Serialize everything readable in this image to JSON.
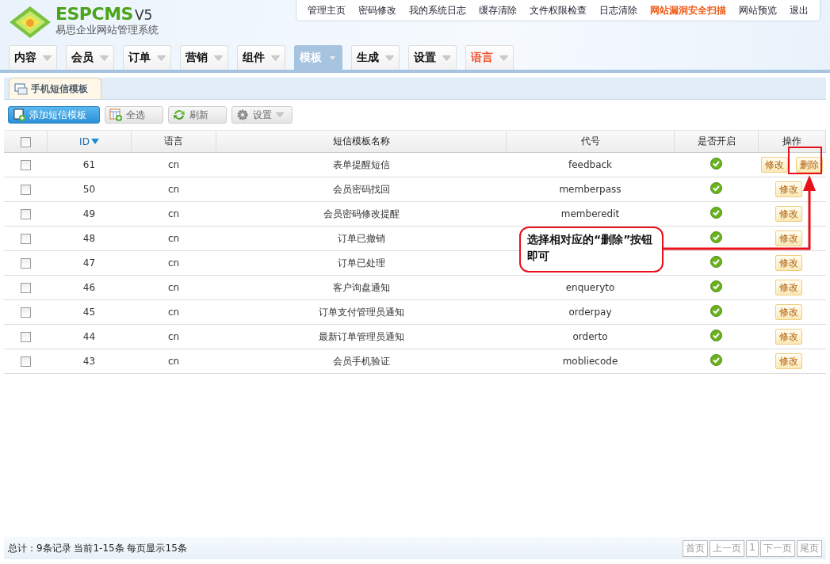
{
  "logo": {
    "brand": "ESPCMS",
    "version": "V5",
    "subtitle": "易思企业网站管理系统"
  },
  "top_links": [
    {
      "label": "管理主页",
      "highlight": false
    },
    {
      "label": "密码修改",
      "highlight": false
    },
    {
      "label": "我的系统日志",
      "highlight": false
    },
    {
      "label": "缓存清除",
      "highlight": false
    },
    {
      "label": "文件权限检查",
      "highlight": false
    },
    {
      "label": "日志清除",
      "highlight": false
    },
    {
      "label": "网站漏洞安全扫描",
      "highlight": true
    },
    {
      "label": "网站预览",
      "highlight": false
    },
    {
      "label": "退出",
      "highlight": false
    }
  ],
  "nav_tabs": [
    {
      "label": "内容",
      "selected": false,
      "highlight": false
    },
    {
      "label": "会员",
      "selected": false,
      "highlight": false
    },
    {
      "label": "订单",
      "selected": false,
      "highlight": false
    },
    {
      "label": "营销",
      "selected": false,
      "highlight": false
    },
    {
      "label": "组件",
      "selected": false,
      "highlight": false
    },
    {
      "label": "模板",
      "selected": true,
      "highlight": false
    },
    {
      "label": "生成",
      "selected": false,
      "highlight": false
    },
    {
      "label": "设置",
      "selected": false,
      "highlight": false
    },
    {
      "label": "语言",
      "selected": false,
      "highlight": true
    }
  ],
  "panel_tab": "手机短信模板",
  "toolbar": [
    {
      "label": "添加短信模板",
      "kind": "primary"
    },
    {
      "label": "全选",
      "kind": "select"
    },
    {
      "label": "刷新",
      "kind": "refresh"
    },
    {
      "label": "设置",
      "kind": "settings"
    }
  ],
  "table": {
    "select_all": {
      "checked": false
    },
    "columns": [
      "ID",
      "语言",
      "短信模板名称",
      "代号",
      "是否开启",
      "操作"
    ],
    "rows": [
      {
        "id": "61",
        "lang": "cn",
        "name": "表单提醒短信",
        "code": "feedback",
        "enabled": true,
        "checked": false,
        "actions": [
          "修改",
          "删除"
        ]
      },
      {
        "id": "50",
        "lang": "cn",
        "name": "会员密码找回",
        "code": "memberpass",
        "enabled": true,
        "checked": false,
        "actions": [
          "修改"
        ]
      },
      {
        "id": "49",
        "lang": "cn",
        "name": "会员密码修改提醒",
        "code": "memberedit",
        "enabled": true,
        "checked": false,
        "actions": [
          "修改"
        ]
      },
      {
        "id": "48",
        "lang": "cn",
        "name": "订单已撤销",
        "enabled": true,
        "checked": false,
        "actions": [
          "修改"
        ]
      },
      {
        "id": "47",
        "lang": "cn",
        "name": "订单已处理",
        "enabled": true,
        "checked": false,
        "actions": [
          "修改"
        ]
      },
      {
        "id": "46",
        "lang": "cn",
        "name": "客户询盘通知",
        "code": "enqueryto",
        "enabled": true,
        "checked": false,
        "actions": [
          "修改"
        ]
      },
      {
        "id": "45",
        "lang": "cn",
        "name": "订单支付管理员通知",
        "code": "orderpay",
        "enabled": true,
        "checked": false,
        "actions": [
          "修改"
        ]
      },
      {
        "id": "44",
        "lang": "cn",
        "name": "最新订单管理员通知",
        "code": "orderto",
        "enabled": true,
        "checked": false,
        "actions": [
          "修改"
        ]
      },
      {
        "id": "43",
        "lang": "cn",
        "name": "会员手机验证",
        "code": "mobliecode",
        "enabled": true,
        "checked": false,
        "actions": [
          "修改"
        ]
      }
    ]
  },
  "callout": "选择相对应的“删除”按钮即可",
  "footer": {
    "summary": "总计：9条记录 当前1-15条 每页显示15条",
    "pager": [
      "首页",
      "上一页",
      "1",
      "下一页",
      "尾页"
    ]
  }
}
